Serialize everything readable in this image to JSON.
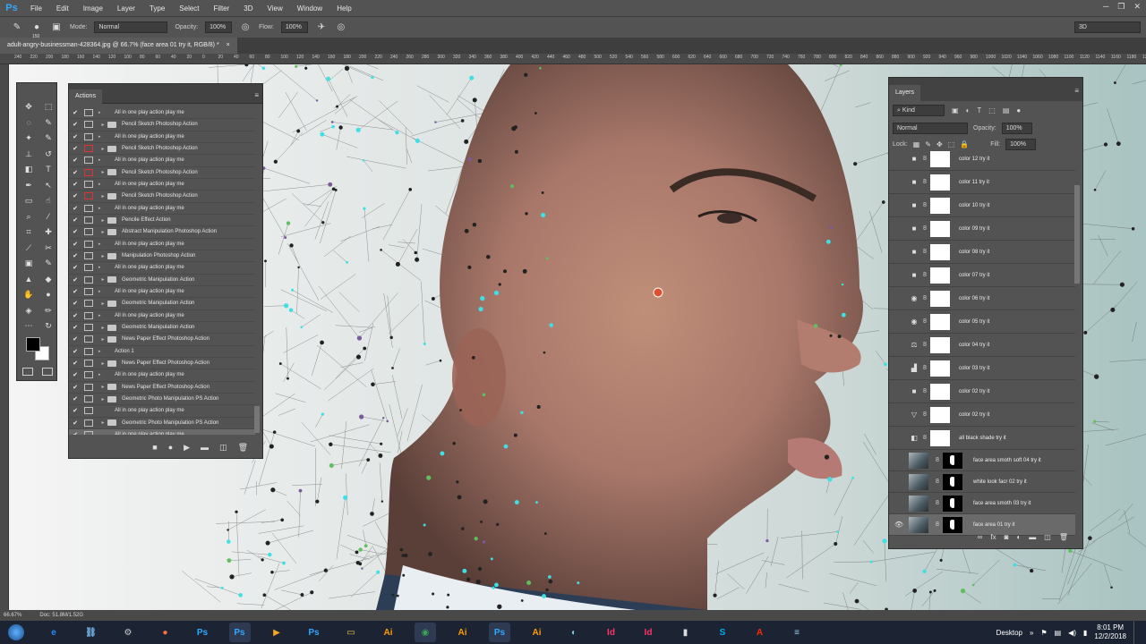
{
  "menubar": {
    "app_logo": "Ps",
    "items": [
      "File",
      "Edit",
      "Image",
      "Layer",
      "Type",
      "Select",
      "Filter",
      "3D",
      "View",
      "Window",
      "Help"
    ]
  },
  "options_bar": {
    "brush_size": "150",
    "mode_label": "Mode:",
    "mode_value": "Normal",
    "opacity_label": "Opacity:",
    "opacity_value": "100%",
    "flow_label": "Flow:",
    "flow_value": "100%",
    "workspace": "3D"
  },
  "document_tab": {
    "title": "adult-angry-businessman-428364.jpg @ 66.7% (face area 01 try it, RGB/8) *",
    "close": "×"
  },
  "ruler_ticks": [
    "240",
    "220",
    "200",
    "180",
    "160",
    "140",
    "120",
    "100",
    "80",
    "60",
    "40",
    "20",
    "0",
    "20",
    "40",
    "60",
    "80",
    "100",
    "120",
    "140",
    "160",
    "180",
    "200",
    "220",
    "240",
    "260",
    "280",
    "300",
    "320",
    "340",
    "360",
    "380",
    "400",
    "420",
    "440",
    "460",
    "480",
    "500",
    "520",
    "540",
    "560",
    "580",
    "600",
    "620",
    "640",
    "660",
    "680",
    "700",
    "720",
    "740",
    "760",
    "780",
    "800",
    "820",
    "840",
    "860",
    "880",
    "900",
    "920",
    "940",
    "960",
    "980",
    "1000",
    "1020",
    "1040",
    "1060",
    "1080",
    "1100",
    "1120",
    "1140",
    "1160",
    "1180",
    "1200"
  ],
  "status_bar": {
    "zoom": "66.67%",
    "doc": "Doc: 51.8M/1.52G"
  },
  "actions_panel": {
    "title": "Actions",
    "rows": [
      {
        "label": "All in one play action play me",
        "kind": "action",
        "red": false
      },
      {
        "label": "Pencil Sketch Photoshop Action",
        "kind": "set",
        "red": false
      },
      {
        "label": "All in one play action play me",
        "kind": "action",
        "red": false
      },
      {
        "label": "Pencil Sketch Photoshop Action",
        "kind": "set",
        "red": true
      },
      {
        "label": "All in one play action play me",
        "kind": "action",
        "red": false
      },
      {
        "label": "Pencil Sketch Photoshop Action",
        "kind": "set",
        "red": true
      },
      {
        "label": "All in one play action play me",
        "kind": "action",
        "red": false
      },
      {
        "label": "Pencil Sketch Photoshop Action",
        "kind": "set",
        "red": true
      },
      {
        "label": "All in one play action play me",
        "kind": "action",
        "red": false
      },
      {
        "label": "Pencile Effect Action",
        "kind": "set",
        "red": false
      },
      {
        "label": "Abstract Manipulation Photoshop Action",
        "kind": "set",
        "red": false
      },
      {
        "label": "All in one play action play me",
        "kind": "action",
        "red": false
      },
      {
        "label": "Manipulation Photoshop Action",
        "kind": "set",
        "red": false
      },
      {
        "label": "All in one play action play me",
        "kind": "action",
        "red": false
      },
      {
        "label": "Geometric Manipulation Action",
        "kind": "set",
        "red": false
      },
      {
        "label": "All in one play action play me",
        "kind": "action",
        "red": false
      },
      {
        "label": "Geometric Manipulation Action",
        "kind": "set",
        "red": false
      },
      {
        "label": "All in one play action play me",
        "kind": "action",
        "red": false
      },
      {
        "label": "Geometric Manipulation Action",
        "kind": "set",
        "red": false
      },
      {
        "label": "News Paper Effect Photoshop Action",
        "kind": "set",
        "red": false
      },
      {
        "label": "Action 1",
        "kind": "action",
        "red": false
      },
      {
        "label": "News Paper Effect Photoshop Action",
        "kind": "set",
        "red": false
      },
      {
        "label": "All in one play action play me",
        "kind": "action",
        "red": false
      },
      {
        "label": "News Paper Effect Photoshop Action",
        "kind": "set",
        "red": false
      },
      {
        "label": "Geometric Photo Manipulation PS Action",
        "kind": "set",
        "red": false
      },
      {
        "label": "All in one play action play me",
        "kind": "action",
        "red": false
      },
      {
        "label": "Geometric Photo Manipulation PS Action",
        "kind": "set",
        "red": false
      },
      {
        "label": "All in one play action play me",
        "kind": "action",
        "red": false
      }
    ]
  },
  "layers_panel": {
    "title": "Layers",
    "filter_kind": "Kind",
    "blend_mode": "Normal",
    "opacity_label": "Opacity:",
    "opacity_value": "100%",
    "lock_label": "Lock:",
    "fill_label": "Fill:",
    "fill_value": "100%",
    "layers": [
      {
        "name": "color 12 try it",
        "icon": "■",
        "thumb": "white",
        "visible": false
      },
      {
        "name": "color 11 try it",
        "icon": "■",
        "thumb": "white",
        "visible": false
      },
      {
        "name": "color 10 try it",
        "icon": "■",
        "thumb": "white",
        "visible": false
      },
      {
        "name": "color 09 try it",
        "icon": "■",
        "thumb": "white",
        "visible": false
      },
      {
        "name": "color 08 try it",
        "icon": "■",
        "thumb": "white",
        "visible": false
      },
      {
        "name": "color 07 try it",
        "icon": "■",
        "thumb": "white",
        "visible": false
      },
      {
        "name": "color 06 try it",
        "icon": "◉",
        "thumb": "white",
        "visible": false
      },
      {
        "name": "color 05 try it",
        "icon": "◉",
        "thumb": "white",
        "visible": false
      },
      {
        "name": "color 04 try it",
        "icon": "⚖",
        "thumb": "white",
        "visible": false
      },
      {
        "name": "color 03 try it",
        "icon": "▟",
        "thumb": "white",
        "visible": false
      },
      {
        "name": "color 02 try it",
        "icon": "■",
        "thumb": "white",
        "visible": false
      },
      {
        "name": "color 02 try it",
        "icon": "▽",
        "thumb": "white",
        "visible": false
      },
      {
        "name": "all black shade try it",
        "icon": "◧",
        "thumb": "white",
        "visible": false
      },
      {
        "name": "face area  smoth soft 04 try it",
        "icon": "",
        "thumb": "image",
        "visible": false
      },
      {
        "name": "white look facr 02 try it",
        "icon": "",
        "thumb": "image",
        "visible": false
      },
      {
        "name": "face area smoth 03 try it",
        "icon": "",
        "thumb": "image",
        "visible": false
      },
      {
        "name": "face area 01 try it",
        "icon": "",
        "thumb": "image",
        "visible": true
      }
    ]
  },
  "taskbar": {
    "desktop_label": "Desktop",
    "time": "8:01 PM",
    "date": "12/2/2018",
    "apps": [
      {
        "id": "ie",
        "label": "e",
        "color": "#1e90ff"
      },
      {
        "id": "network",
        "label": "⛓",
        "color": "#6fa8dc"
      },
      {
        "id": "settings",
        "label": "⚙",
        "color": "#cccccc"
      },
      {
        "id": "firefox",
        "label": "●",
        "color": "#ff7139"
      },
      {
        "id": "photoshop1",
        "label": "Ps",
        "color": "#31a8ff"
      },
      {
        "id": "photoshop2",
        "label": "Ps",
        "color": "#31a8ff"
      },
      {
        "id": "media",
        "label": "▶",
        "color": "#f5a623"
      },
      {
        "id": "photoshop3",
        "label": "Ps",
        "color": "#31a8ff"
      },
      {
        "id": "explorer",
        "label": "▭",
        "color": "#f0c24b"
      },
      {
        "id": "illustrator1",
        "label": "Ai",
        "color": "#ff9a00"
      },
      {
        "id": "chrome",
        "label": "◉",
        "color": "#34a853"
      },
      {
        "id": "illustrator2",
        "label": "Ai",
        "color": "#ff9a00"
      },
      {
        "id": "photoshop4",
        "label": "Ps",
        "color": "#31a8ff"
      },
      {
        "id": "illustrator3",
        "label": "Ai",
        "color": "#ff9a00"
      },
      {
        "id": "paint",
        "label": "◐",
        "color": "#7ec8e3"
      },
      {
        "id": "indesign1",
        "label": "Id",
        "color": "#ff3366"
      },
      {
        "id": "indesign2",
        "label": "Id",
        "color": "#ff3366"
      },
      {
        "id": "film",
        "label": "▮",
        "color": "#dddddd"
      },
      {
        "id": "skype",
        "label": "S",
        "color": "#00aff0"
      },
      {
        "id": "acrobat",
        "label": "A",
        "color": "#ff2a00"
      },
      {
        "id": "notepad",
        "label": "≡",
        "color": "#9ecbe8"
      }
    ]
  }
}
